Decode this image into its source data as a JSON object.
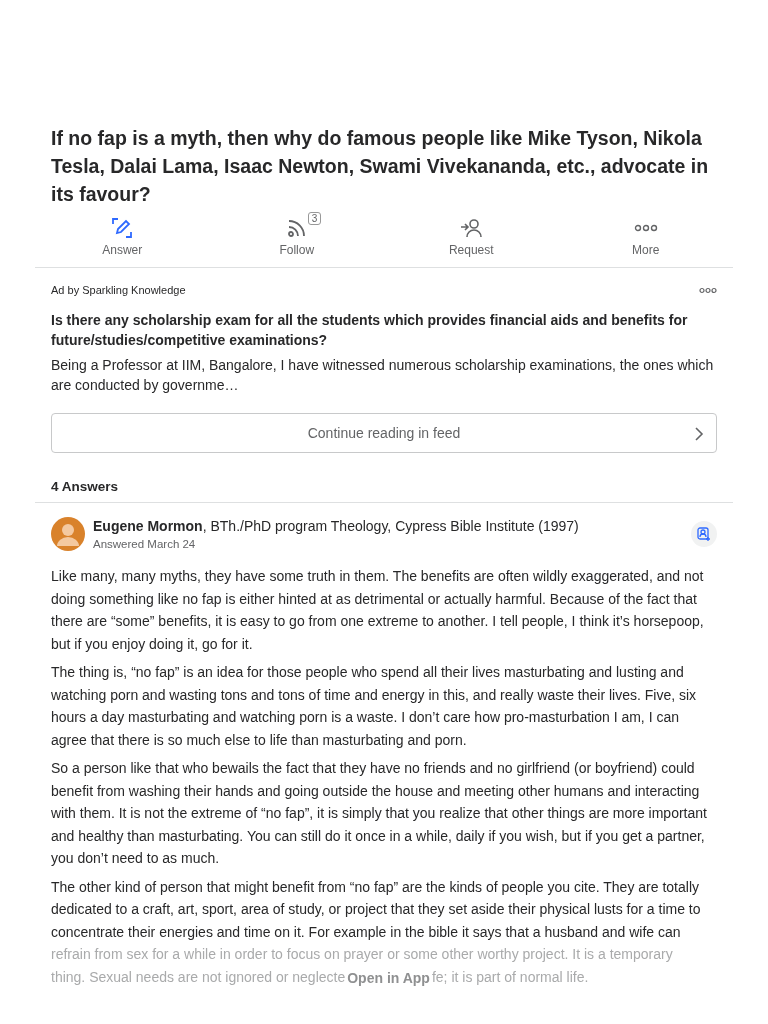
{
  "question": {
    "title": "If no fap is a myth, then why do famous people like Mike Tyson, Nikola Tesla, Dalai Lama, Isaac Newton, Swami Vivekananda, etc., advocate in its favour?",
    "actions": [
      {
        "kind": "answer",
        "label": "Answer"
      },
      {
        "kind": "follow",
        "label": "Follow",
        "count": "3"
      },
      {
        "kind": "request",
        "label": "Request"
      },
      {
        "kind": "more",
        "label": "More"
      }
    ]
  },
  "ad": {
    "sponsor": "Ad by Sparkling Knowledge",
    "title": "Is there any scholarship exam for all the students which provides financial aids and benefits for future/studies/competitive examinations?",
    "excerpt": "Being a Professor at IIM, Bangalore, I have witnessed numerous scholarship examinations, the ones which are conducted by governme…",
    "button": "Continue reading in feed"
  },
  "answers_count": "4 Answers",
  "answer": {
    "byline": "**Eugene Mormon**, BTh./PhD program Theology, Cypress Bible Institute (1997)",
    "date": "Answered March 24",
    "paragraphs": [
      "Like many, many myths, they have some truth in them. The benefits are often wildly exaggerated, and not doing something like no fap is either hinted at as detrimental or actually harmful. Because of the fact that there are “some” benefits, it is easy to go from one extreme to another. I tell people, I think it’s horsepoop, but if you enjoy doing it, go for it.",
      "The thing is, “no fap” is an idea for those people who spend all their lives masturbating and lusting and watching porn and wasting tons and tons of time and energy in this, and really waste their lives. Five, six hours a day masturbating and watching porn is a waste. I don’t care how pro-masturbation I am, I can agree that there is so much else to life than masturbating and porn.",
      "So a person like that who bewails the fact that they have no friends and no girlfriend (or boyfriend) could benefit from washing their hands and going outside the house and meeting other humans and interacting with them. It is not the extreme of “no fap”, it is simply that you realize that other things are more important and healthy than masturbating. You can still do it once in a while, daily if you wish, but if you get a partner, you don’t need to as much.",
      "The other kind of person that might benefit from “no fap” are the kinds of people you cite. They are totally dedicated to a craft, art, sport, area of study, or project that they set aside their physical lusts for a time to concentrate their energies and time on it. For example in the bible it says that a husband and wife can"
    ],
    "faded": {
      "line": "refrain from sex for a while in order to focus on prayer or some other worthy project. It is a temporary",
      "before": "thing. Sexual needs are not ignored or neglecte",
      "after": "fe; it is part of normal life."
    }
  },
  "open_app": "Open in App"
}
